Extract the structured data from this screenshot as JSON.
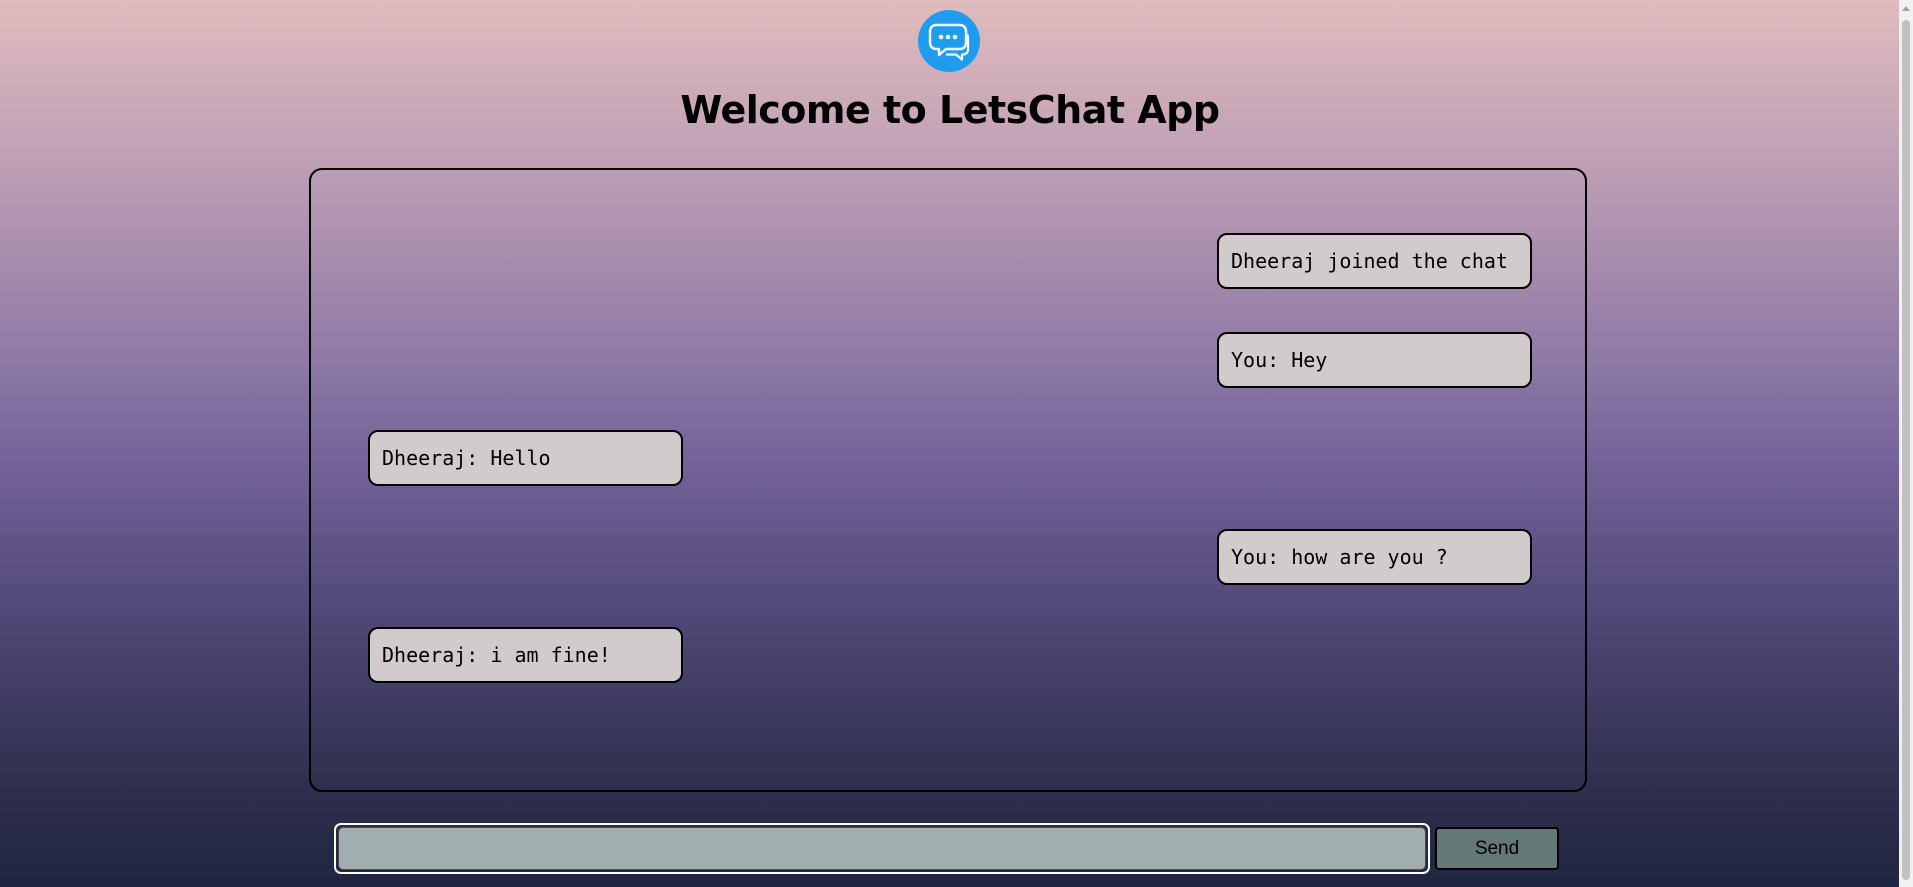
{
  "app": {
    "title": "Welcome to LetsChat App",
    "logo_icon": "chat-bubbles-icon",
    "logo_color": "#1e9cf0"
  },
  "messages": [
    {
      "text": "Dheeraj joined the chat",
      "side": "right"
    },
    {
      "text": "You: Hey",
      "side": "right"
    },
    {
      "text": "Dheeraj: Hello",
      "side": "left"
    },
    {
      "text": "You: how are you ?",
      "side": "right"
    },
    {
      "text": "Dheeraj: i am fine!",
      "side": "left"
    }
  ],
  "composer": {
    "value": "",
    "placeholder": "",
    "send_label": "Send"
  },
  "colors": {
    "bubble_bg": "#d2cbcb",
    "input_bg": "#a1aeae",
    "send_bg": "#647878"
  }
}
